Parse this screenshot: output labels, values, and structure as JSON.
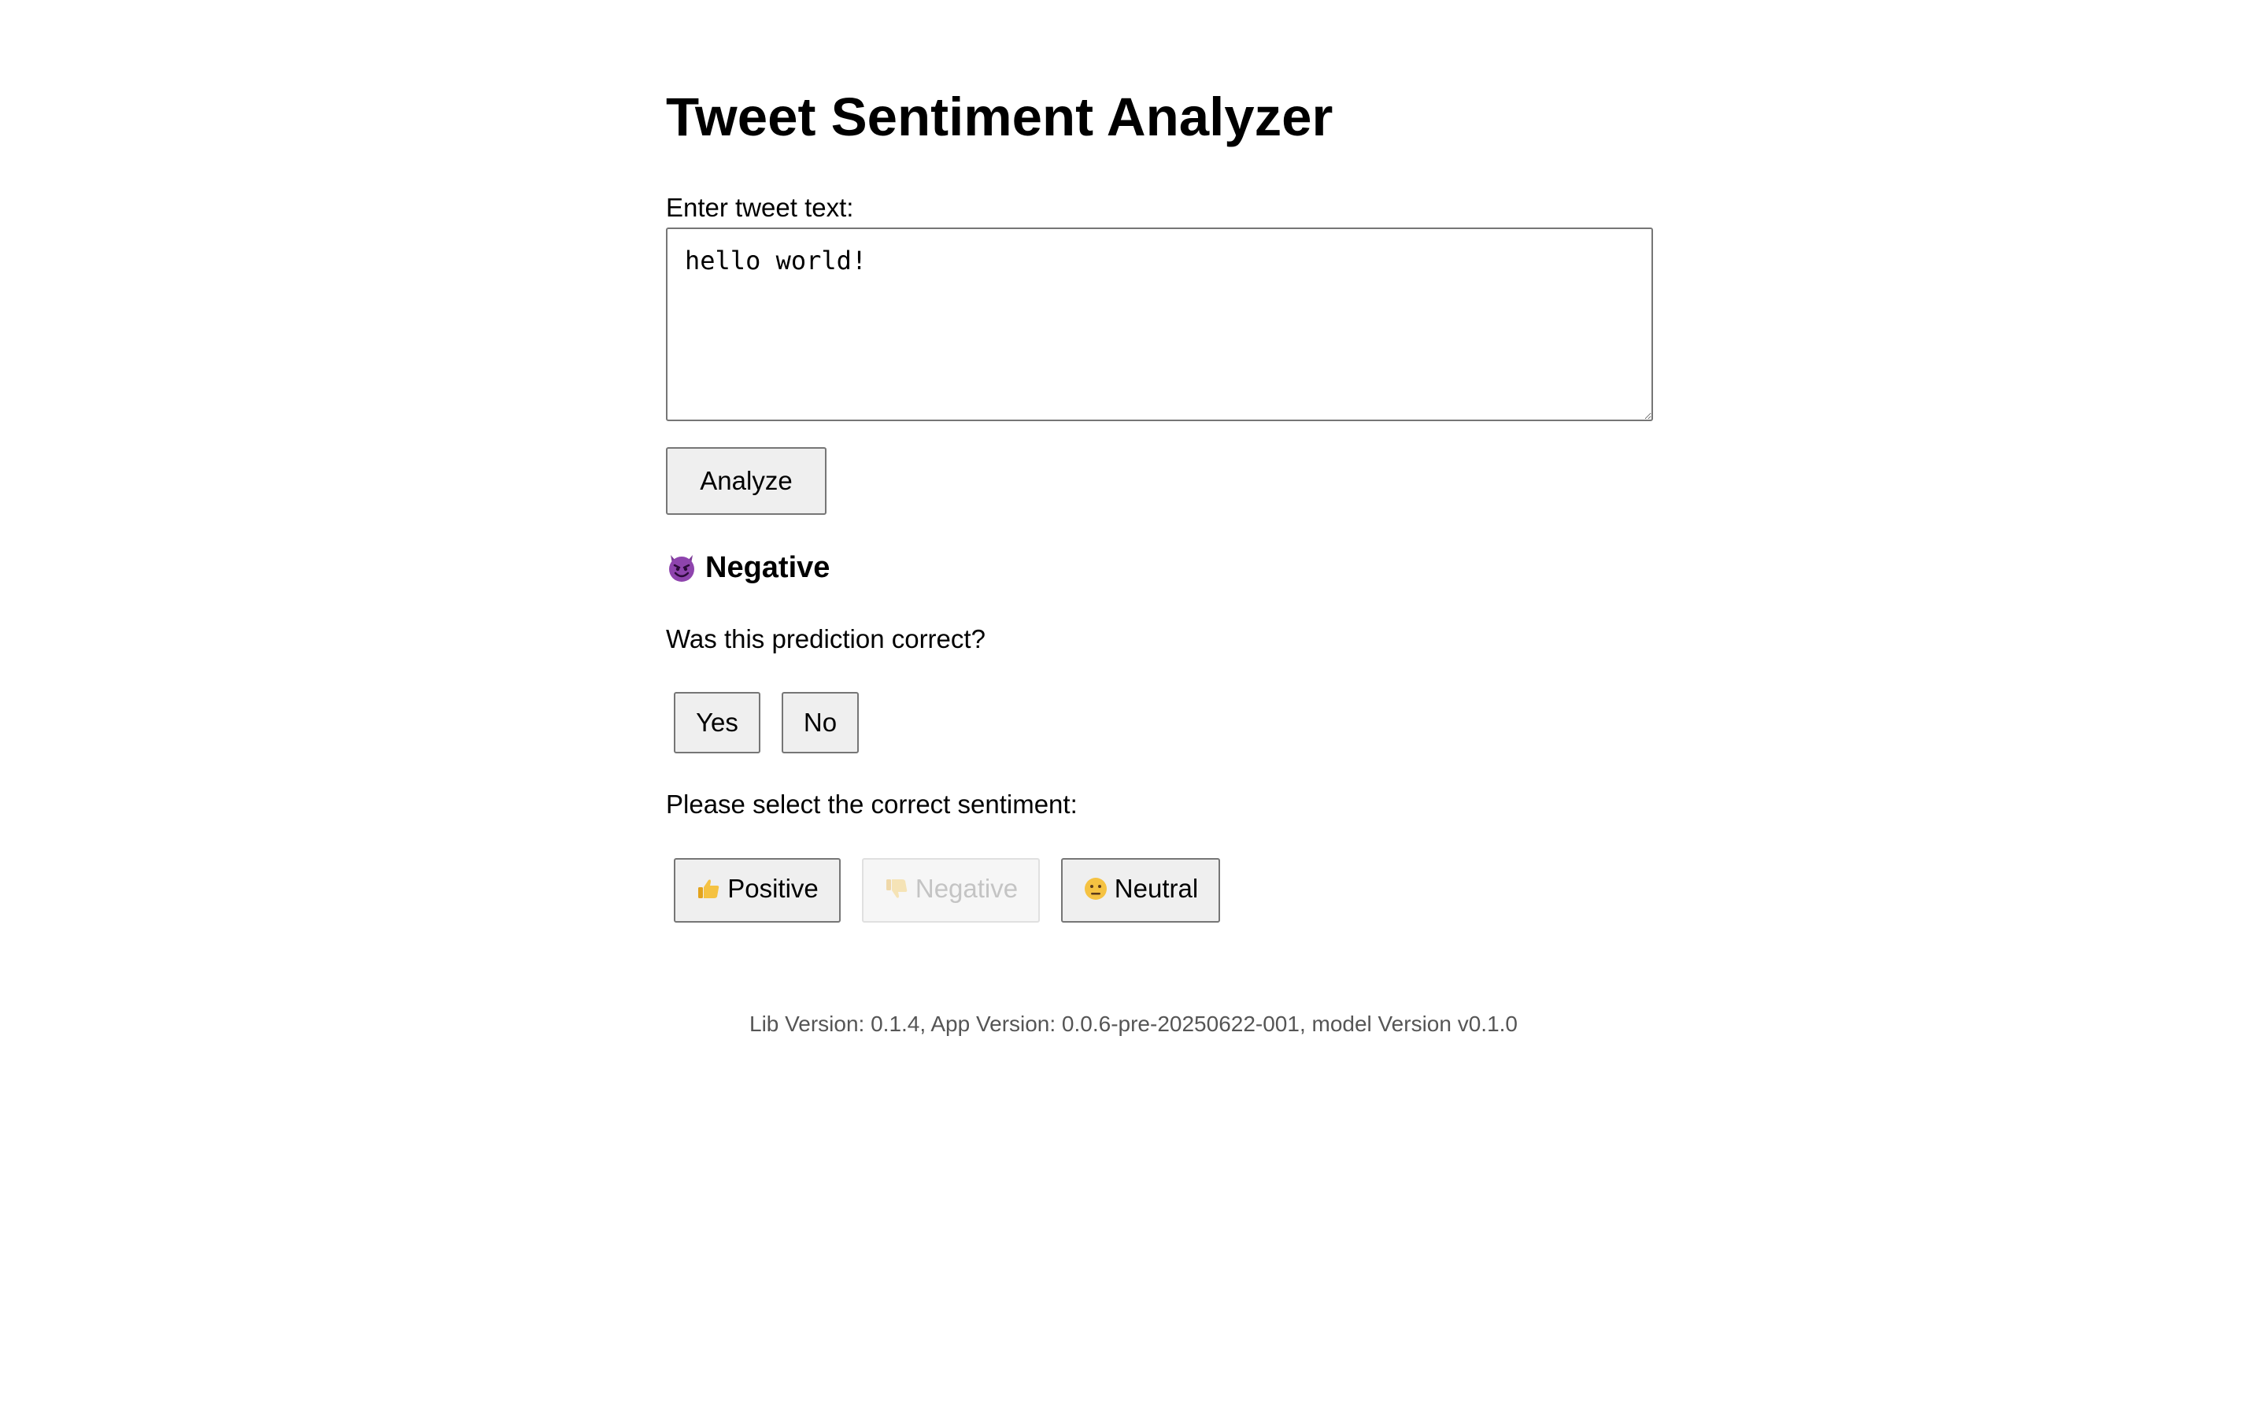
{
  "page": {
    "title": "Tweet Sentiment Analyzer"
  },
  "input": {
    "label": "Enter tweet text:",
    "value": "hello world!"
  },
  "analyze_button": {
    "label": "Analyze"
  },
  "result": {
    "icon": "smiling-devil-icon",
    "label": "Negative"
  },
  "feedback": {
    "question": "Was this prediction correct?",
    "yes_label": "Yes",
    "no_label": "No",
    "select_prompt": "Please select the correct sentiment:",
    "options": [
      {
        "icon": "thumbs-up-icon",
        "label": "Positive",
        "disabled": false
      },
      {
        "icon": "thumbs-down-icon",
        "label": "Negative",
        "disabled": true
      },
      {
        "icon": "neutral-face-icon",
        "label": "Neutral",
        "disabled": false
      }
    ]
  },
  "footer": {
    "text": "Lib Version: 0.1.4, App Version: 0.0.6-pre-20250622-001, model Version v0.1.0"
  },
  "colors": {
    "button_bg": "#efefef",
    "button_border": "#767676",
    "disabled_text": "#c4c4c4",
    "footer_text": "#555555",
    "devil_purple": "#8e44ad"
  }
}
